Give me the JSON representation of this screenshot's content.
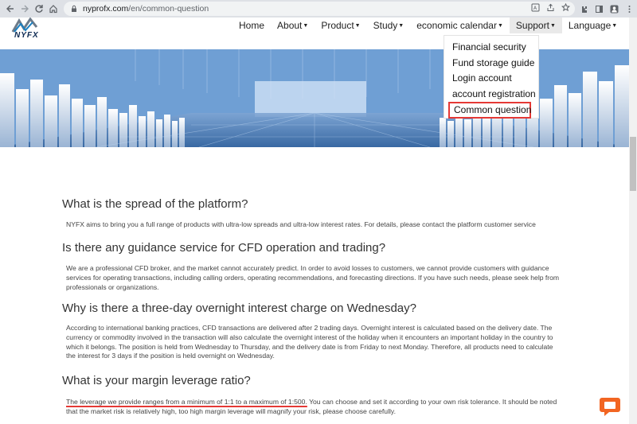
{
  "browser": {
    "url_host": "nyprofx.com",
    "url_path": "/en/common-question"
  },
  "site": {
    "logo_text": "NYFX",
    "nav": [
      {
        "label": "Home",
        "has_caret": false
      },
      {
        "label": "About",
        "has_caret": true
      },
      {
        "label": "Product",
        "has_caret": true
      },
      {
        "label": "Study",
        "has_caret": true
      },
      {
        "label": "economic calendar",
        "has_caret": true
      },
      {
        "label": "Support",
        "has_caret": true,
        "active": true
      },
      {
        "label": "Language",
        "has_caret": true
      }
    ],
    "support_menu": [
      "Financial security",
      "Fund storage guide",
      "Login account",
      "account registration",
      "Common question"
    ],
    "highlighted_menu_item": "Common question"
  },
  "faq": [
    {
      "question": "What is the spread of the platform?",
      "answer": "NYFX aims to bring you a full range of products with ultra-low spreads and ultra-low interest rates. For details, please contact the platform customer service"
    },
    {
      "question": "Is there any guidance service for CFD operation and trading?",
      "answer": "We are a professional CFD broker, and the market cannot accurately predict. In order to avoid losses to customers, we cannot provide customers with guidance services for operating transactions, including calling orders, operating recommendations, and forecasting directions. If you have such needs, please seek help from professionals or organizations."
    },
    {
      "question": "Why is there a three-day overnight interest charge on Wednesday?",
      "answer": "According to international banking practices, CFD transactions are delivered after 2 trading days. Overnight interest is calculated based on the delivery date. The currency or commodity involved in the transaction will also calculate the overnight interest of the holiday when it encounters an important holiday in the country to which it belongs. The position is held from Wednesday to Thursday, and the delivery date is from Friday to next Monday. Therefore, all products need to calculate the interest for 3 days if the position is held overnight on Wednesday."
    },
    {
      "question": "What is your margin leverage ratio?",
      "answer_underlined": "The leverage we provide ranges from a minimum of 1:1 to a maximum of 1:500.",
      "answer": " You can choose and set it according to your own risk tolerance. It should be noted that the market risk is relatively high, too high margin leverage will magnify your risk, please choose carefully."
    }
  ],
  "colors": {
    "highlight_box": "#e53935",
    "underline": "#e53935",
    "chat_button": "#f26522"
  }
}
